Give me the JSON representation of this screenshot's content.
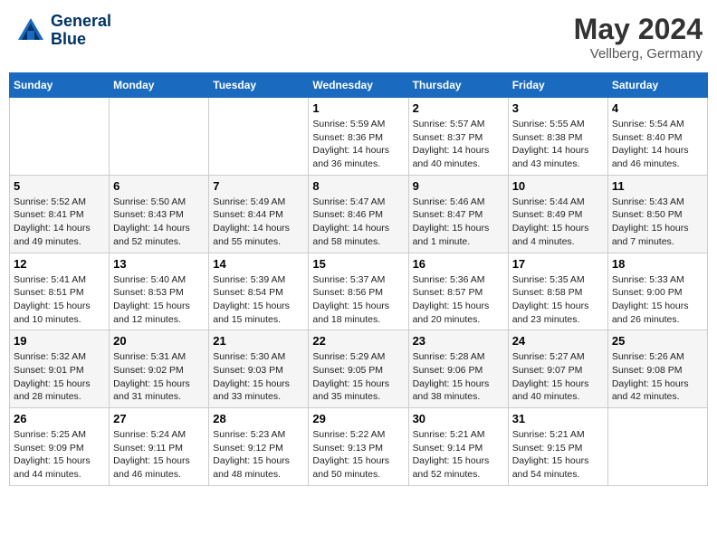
{
  "header": {
    "logo_line1": "General",
    "logo_line2": "Blue",
    "month_year": "May 2024",
    "location": "Vellberg, Germany"
  },
  "weekdays": [
    "Sunday",
    "Monday",
    "Tuesday",
    "Wednesday",
    "Thursday",
    "Friday",
    "Saturday"
  ],
  "weeks": [
    [
      {
        "day": "",
        "info": ""
      },
      {
        "day": "",
        "info": ""
      },
      {
        "day": "",
        "info": ""
      },
      {
        "day": "1",
        "info": "Sunrise: 5:59 AM\nSunset: 8:36 PM\nDaylight: 14 hours\nand 36 minutes."
      },
      {
        "day": "2",
        "info": "Sunrise: 5:57 AM\nSunset: 8:37 PM\nDaylight: 14 hours\nand 40 minutes."
      },
      {
        "day": "3",
        "info": "Sunrise: 5:55 AM\nSunset: 8:38 PM\nDaylight: 14 hours\nand 43 minutes."
      },
      {
        "day": "4",
        "info": "Sunrise: 5:54 AM\nSunset: 8:40 PM\nDaylight: 14 hours\nand 46 minutes."
      }
    ],
    [
      {
        "day": "5",
        "info": "Sunrise: 5:52 AM\nSunset: 8:41 PM\nDaylight: 14 hours\nand 49 minutes."
      },
      {
        "day": "6",
        "info": "Sunrise: 5:50 AM\nSunset: 8:43 PM\nDaylight: 14 hours\nand 52 minutes."
      },
      {
        "day": "7",
        "info": "Sunrise: 5:49 AM\nSunset: 8:44 PM\nDaylight: 14 hours\nand 55 minutes."
      },
      {
        "day": "8",
        "info": "Sunrise: 5:47 AM\nSunset: 8:46 PM\nDaylight: 14 hours\nand 58 minutes."
      },
      {
        "day": "9",
        "info": "Sunrise: 5:46 AM\nSunset: 8:47 PM\nDaylight: 15 hours\nand 1 minute."
      },
      {
        "day": "10",
        "info": "Sunrise: 5:44 AM\nSunset: 8:49 PM\nDaylight: 15 hours\nand 4 minutes."
      },
      {
        "day": "11",
        "info": "Sunrise: 5:43 AM\nSunset: 8:50 PM\nDaylight: 15 hours\nand 7 minutes."
      }
    ],
    [
      {
        "day": "12",
        "info": "Sunrise: 5:41 AM\nSunset: 8:51 PM\nDaylight: 15 hours\nand 10 minutes."
      },
      {
        "day": "13",
        "info": "Sunrise: 5:40 AM\nSunset: 8:53 PM\nDaylight: 15 hours\nand 12 minutes."
      },
      {
        "day": "14",
        "info": "Sunrise: 5:39 AM\nSunset: 8:54 PM\nDaylight: 15 hours\nand 15 minutes."
      },
      {
        "day": "15",
        "info": "Sunrise: 5:37 AM\nSunset: 8:56 PM\nDaylight: 15 hours\nand 18 minutes."
      },
      {
        "day": "16",
        "info": "Sunrise: 5:36 AM\nSunset: 8:57 PM\nDaylight: 15 hours\nand 20 minutes."
      },
      {
        "day": "17",
        "info": "Sunrise: 5:35 AM\nSunset: 8:58 PM\nDaylight: 15 hours\nand 23 minutes."
      },
      {
        "day": "18",
        "info": "Sunrise: 5:33 AM\nSunset: 9:00 PM\nDaylight: 15 hours\nand 26 minutes."
      }
    ],
    [
      {
        "day": "19",
        "info": "Sunrise: 5:32 AM\nSunset: 9:01 PM\nDaylight: 15 hours\nand 28 minutes."
      },
      {
        "day": "20",
        "info": "Sunrise: 5:31 AM\nSunset: 9:02 PM\nDaylight: 15 hours\nand 31 minutes."
      },
      {
        "day": "21",
        "info": "Sunrise: 5:30 AM\nSunset: 9:03 PM\nDaylight: 15 hours\nand 33 minutes."
      },
      {
        "day": "22",
        "info": "Sunrise: 5:29 AM\nSunset: 9:05 PM\nDaylight: 15 hours\nand 35 minutes."
      },
      {
        "day": "23",
        "info": "Sunrise: 5:28 AM\nSunset: 9:06 PM\nDaylight: 15 hours\nand 38 minutes."
      },
      {
        "day": "24",
        "info": "Sunrise: 5:27 AM\nSunset: 9:07 PM\nDaylight: 15 hours\nand 40 minutes."
      },
      {
        "day": "25",
        "info": "Sunrise: 5:26 AM\nSunset: 9:08 PM\nDaylight: 15 hours\nand 42 minutes."
      }
    ],
    [
      {
        "day": "26",
        "info": "Sunrise: 5:25 AM\nSunset: 9:09 PM\nDaylight: 15 hours\nand 44 minutes."
      },
      {
        "day": "27",
        "info": "Sunrise: 5:24 AM\nSunset: 9:11 PM\nDaylight: 15 hours\nand 46 minutes."
      },
      {
        "day": "28",
        "info": "Sunrise: 5:23 AM\nSunset: 9:12 PM\nDaylight: 15 hours\nand 48 minutes."
      },
      {
        "day": "29",
        "info": "Sunrise: 5:22 AM\nSunset: 9:13 PM\nDaylight: 15 hours\nand 50 minutes."
      },
      {
        "day": "30",
        "info": "Sunrise: 5:21 AM\nSunset: 9:14 PM\nDaylight: 15 hours\nand 52 minutes."
      },
      {
        "day": "31",
        "info": "Sunrise: 5:21 AM\nSunset: 9:15 PM\nDaylight: 15 hours\nand 54 minutes."
      },
      {
        "day": "",
        "info": ""
      }
    ]
  ]
}
